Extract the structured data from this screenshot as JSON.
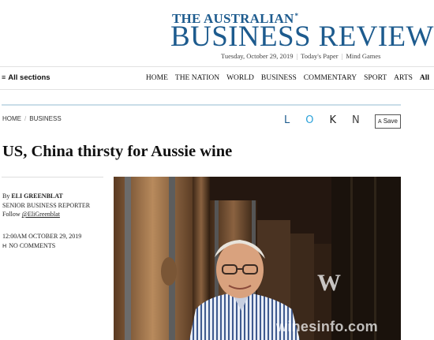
{
  "masthead": {
    "top_line": "THE AUSTRALIAN",
    "trademark": "*",
    "title": "BUSINESS REVIEW",
    "date": "Tuesday, October 29, 2019",
    "todays_paper": "Today's Paper",
    "mind_games": "Mind Games",
    "brand_color": "#1d5b8e"
  },
  "nav": {
    "sections_icon": "menu-icon",
    "sections_glyph": "≡",
    "sections_label": "All sections",
    "items": [
      "HOME",
      "THE NATION",
      "WORLD",
      "BUSINESS",
      "COMMENTARY",
      "SPORT",
      "ARTS",
      "All"
    ]
  },
  "breadcrumb": {
    "home": "HOME",
    "section": "BUSINESS"
  },
  "share": {
    "icons": [
      "linkedin-icon",
      "twitter-icon",
      "facebook-icon",
      "email-icon"
    ],
    "glyphs": [
      "L",
      "O",
      "K",
      "N"
    ],
    "save_icon": "bookmark-icon",
    "save_glyph": "A",
    "save_label": "Save"
  },
  "article": {
    "headline": "US, China thirsty for Aussie wine",
    "author_prefix": "By",
    "author": "ELI GREENBLAT",
    "author_role": "SENIOR BUSINESS REPORTER",
    "follow_prefix": "Follow",
    "follow_handle": "@EliGreenblat",
    "timestamp": "12:00AM OCTOBER 29, 2019",
    "comments_glyph": "H",
    "comments": "NO COMMENTS"
  },
  "photo": {
    "watermark_text": "winesinfo.com",
    "watermark_logo": "W"
  }
}
